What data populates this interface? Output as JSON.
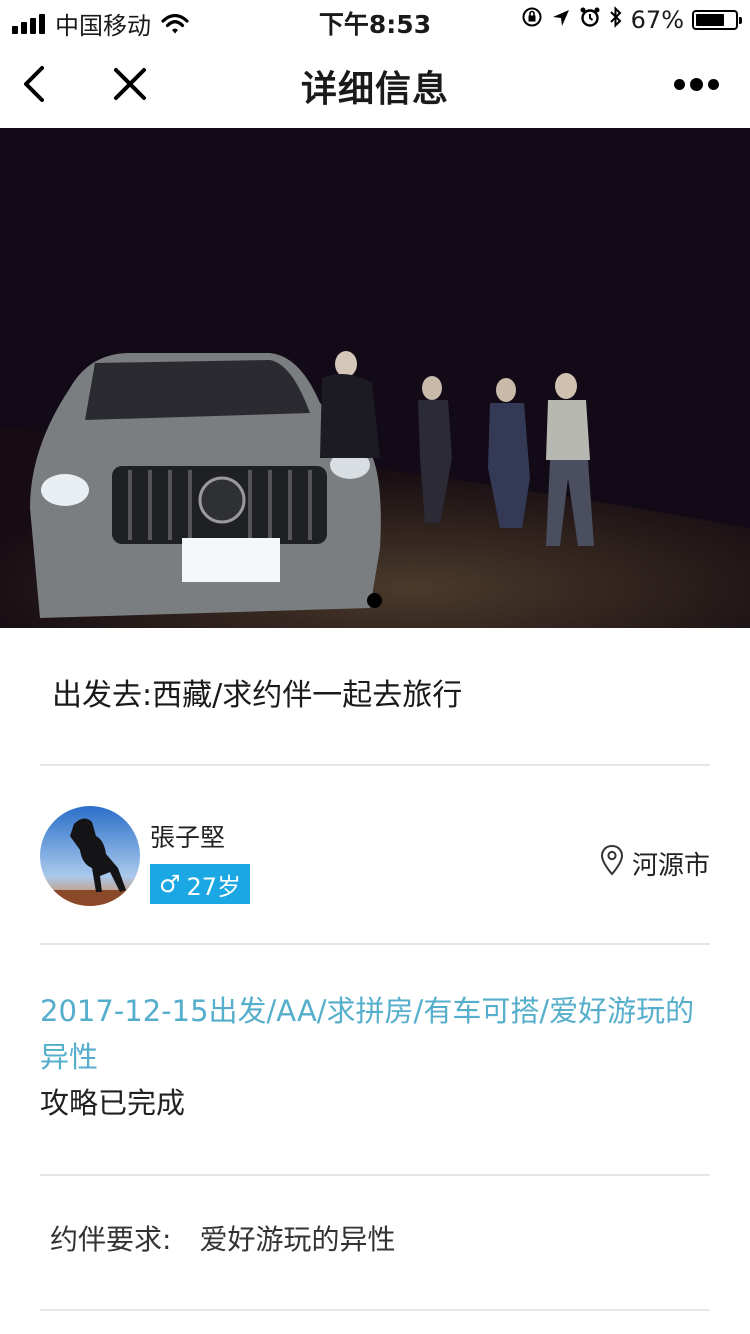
{
  "status_bar": {
    "carrier": "中国移动",
    "time": "下午8:53",
    "battery": "67%",
    "battery_level": 0.67,
    "icons": [
      "signal-icon",
      "wifi-icon",
      "orientation-lock-icon",
      "location-arrow-icon",
      "alarm-icon",
      "bluetooth-icon",
      "battery-icon"
    ]
  },
  "nav": {
    "title": "详细信息",
    "icons": [
      "back-chevron-icon",
      "close-icon",
      "more-dots-icon"
    ]
  },
  "hero": {
    "page_count": 1,
    "current_page": 1
  },
  "trip": {
    "title": "出发去:西藏/求约伴一起去旅行"
  },
  "user": {
    "name": "張子堅",
    "gender_symbol": "♂",
    "age": "27岁",
    "location": "河源市",
    "badge_color": "#1aa7e3"
  },
  "details": {
    "tags": "2017-12-15出发/AA/求拼房/有车可搭/爱好游玩的异性",
    "status": "攻略已完成",
    "tag_color": "#55aecb"
  },
  "requirement": {
    "label": "约伴要求:",
    "value": "爱好游玩的异性"
  }
}
